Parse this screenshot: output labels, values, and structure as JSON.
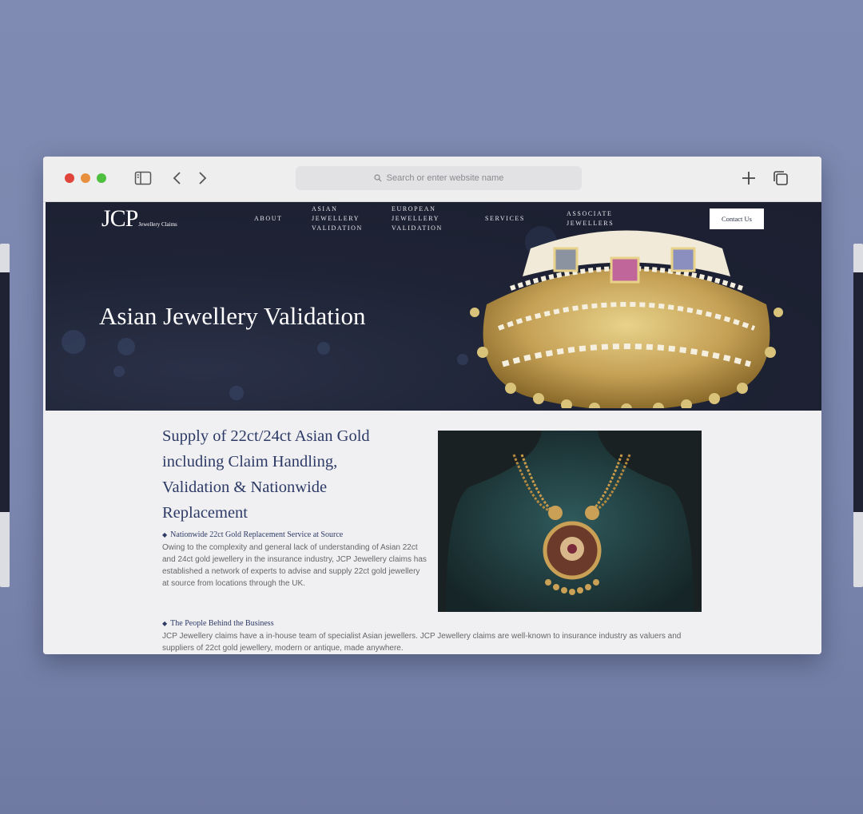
{
  "browser": {
    "address_placeholder": "Search or enter website name"
  },
  "site": {
    "logo_main": "JCP",
    "logo_sub": "Jewellery Claims",
    "nav": {
      "about": "ABOUT",
      "asian": [
        "ASIAN",
        "JEWELLERY",
        "VALIDATION"
      ],
      "european": [
        "EUROPEAN",
        "JEWELLERY",
        "VALIDATION"
      ],
      "services": "SERVICES",
      "associate": [
        "ASSOCIATE",
        "JEWELLERS"
      ]
    },
    "contact_label": "Contact Us",
    "hero_title": "Asian Jewellery Validation"
  },
  "content": {
    "heading_lines": [
      "Supply of 22ct/24ct Asian Gold",
      "including Claim Handling,",
      "Validation & Nationwide",
      "Replacement"
    ],
    "bullet_glyph": "◆",
    "section1": {
      "title": "Nationwide 22ct Gold Replacement Service at Source",
      "lines": [
        "Owing to the complexity and general lack of understanding of Asian 22ct",
        "and 24ct gold jewellery in the insurance industry, JCP Jewellery claims has",
        "established a network of experts to advise and supply 22ct gold jewellery",
        "at source from locations through the UK."
      ]
    },
    "section2": {
      "title": "The People Behind the Business",
      "lines": [
        "JCP Jewellery claims have a in-house team of specialist Asian jewellers. JCP Jewellery claims are well-known to insurance industry as valuers and",
        "suppliers of 22ct gold jewellery, modern or antique, made anywhere."
      ]
    }
  },
  "icons": [
    "sidebar-icon",
    "back-icon",
    "forward-icon",
    "search-icon",
    "new-tab-icon",
    "tab-overview-icon"
  ],
  "colors": {
    "background": "#7f8bb2",
    "hero_bg": "#1e2335",
    "heading": "#2d3a66",
    "traffic_red": "#e0443b",
    "traffic_orange": "#e9903e",
    "traffic_green": "#4fbf3f"
  }
}
